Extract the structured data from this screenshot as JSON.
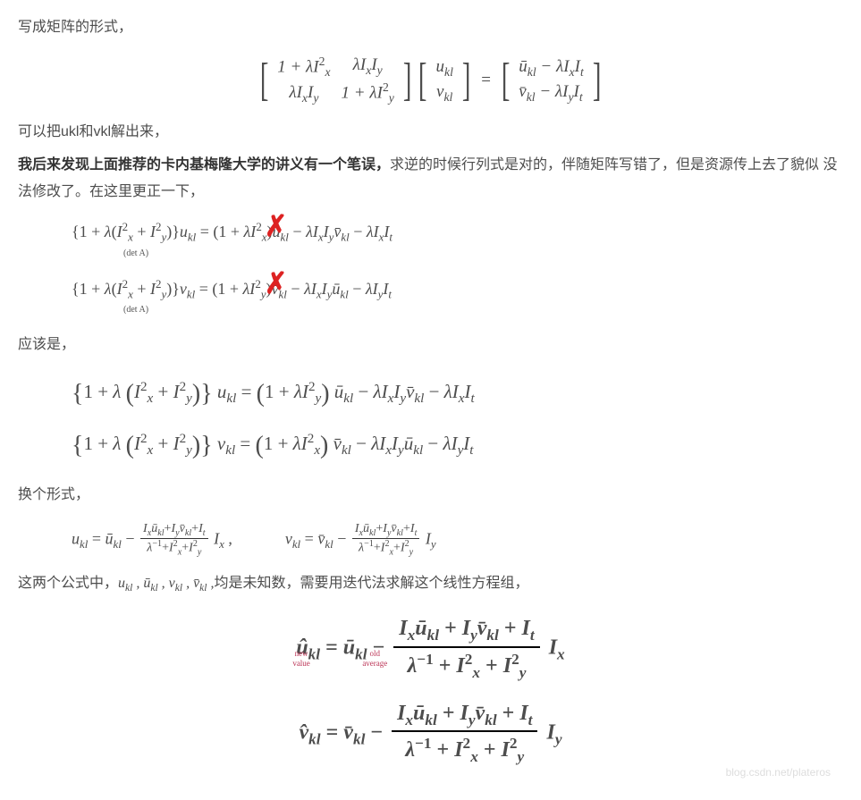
{
  "para1": "写成矩阵的形式，",
  "matrix": {
    "m11": "1 + λI",
    "m11_sub": "x",
    "m11_sup": "2",
    "m12": "λI",
    "m12_sub1": "x",
    "m12_I2": "I",
    "m12_sub2": "y",
    "m21": "λI",
    "m21_sub1": "x",
    "m21_I2": "I",
    "m21_sub2": "y",
    "m22": "1 + λI",
    "m22_sub": "y",
    "m22_sup": "2",
    "v1": "u",
    "v1_sub": "kl",
    "v2": "v",
    "v2_sub": "kl",
    "eq": "=",
    "r1_a": "ū",
    "r1_a_sub": "kl",
    "r1_b": " − λI",
    "r1_b_sub": "x",
    "r1_c": "I",
    "r1_c_sub": "t",
    "r2_a": "v̄",
    "r2_a_sub": "kl",
    "r2_b": " − λI",
    "r2_b_sub": "y",
    "r2_c": "I",
    "r2_c_sub": "t"
  },
  "para2": "可以把ukl和vkl解出来，",
  "para3_bold": "我后来发现上面推荐的卡内基梅隆大学的讲义有一个笔误，",
  "para3_rest": "求逆的时候行列式是对的，伴随矩阵写错了，但是资源传上去了貌似 没法修改了。在这里更正一下，",
  "deriv": {
    "line1": "{1 + λ(Iₓ² + Iᵧ²)}u_kl = (1 + λI_x²)ū_kl − λIₓIᵧv̄_kl − λIₓI_t",
    "det1": "(det A)",
    "line2": "{1 + λ(Iₓ² + Iᵧ²)}v_kl = (1 + λI_y²)v̄_kl − λIₓIᵧū_kl − λIᵧI_t",
    "det2": "(det A)"
  },
  "para4": "应该是，",
  "corr": {
    "line1_left": "{1 + λ (Iₓ² + Iᵧ²)} u_kl = (1 + λIᵧ²) ū_kl − λIₓIᵧv̄_kl − λIₓI_t",
    "line2_left": "{1 + λ (Iₓ² + Iᵧ²)} v_kl = (1 + λIₓ²) v̄_kl − λIₓIᵧū_kl − λIᵧI_t"
  },
  "para5": "换个形式，",
  "compact": {
    "u_lhs": "u_kl = ū_kl − ",
    "u_num": "Iₓū_kl + Iᵧv̄_kl + I_t",
    "u_den": "λ⁻¹ + Iₓ² + Iᵧ²",
    "u_tail": "Iₓ ,",
    "v_lhs": "v_kl = v̄_kl − ",
    "v_num": "Iₓū_kl + Iᵧv̄_kl + I_t",
    "v_den": "λ⁻¹ + Iₓ² + Iᵧ²",
    "v_tail": "Iᵧ"
  },
  "para6_a": "这两个公式中，",
  "para6_math": "u_kl , ū_kl , v_kl , v̄_kl ,",
  "para6_b": "均是未知数，需要用迭代法求解这个线性方程组，",
  "final": {
    "u_lhs": "û_kl = ū_kl − ",
    "u_num": "Iₓū_kl + Iᵧv̄_kl + I_t",
    "u_den": "λ⁻¹ + Iₓ² + Iᵧ²",
    "u_tail": " Iₓ",
    "new_label": "new\nvalue",
    "old_label": "old\naverage",
    "v_lhs": "v̂_kl = v̄_kl − ",
    "v_num": "Iₓū_kl + Iᵧv̄_kl + I_t",
    "v_den": "λ⁻¹ + Iₓ² + Iᵧ²",
    "v_tail": " Iᵧ"
  },
  "watermark": "blog.csdn.net/plateros"
}
